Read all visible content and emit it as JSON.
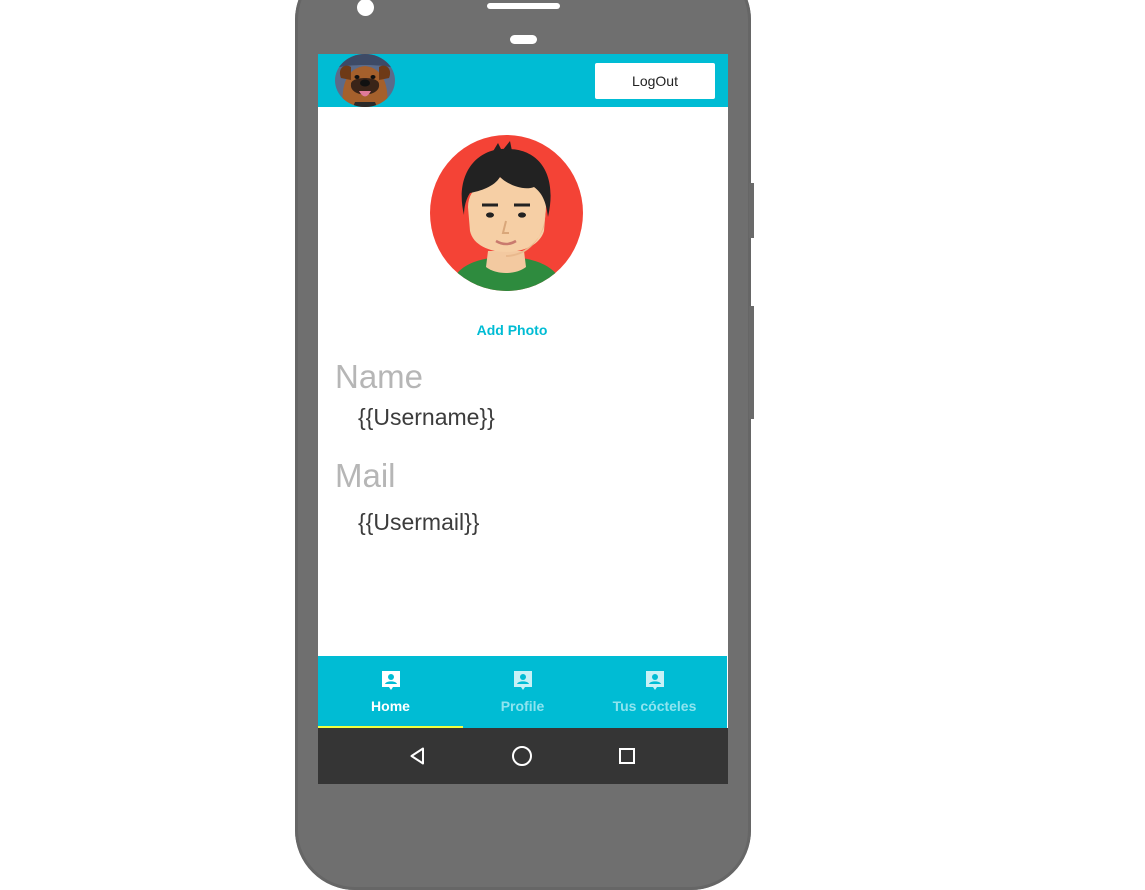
{
  "appbar": {
    "avatar_icon": "dog-avatar",
    "logout_label": "LogOut"
  },
  "profile": {
    "photo_icon": "user-avatar",
    "add_photo_label": "Add Photo",
    "name_label": "Name",
    "name_value": "{{Username}}",
    "mail_label": "Mail",
    "mail_value": "{{Usermail}}"
  },
  "tabs": [
    {
      "label": "Home",
      "icon": "account-box-icon",
      "active": true
    },
    {
      "label": "Profile",
      "icon": "account-box-icon",
      "active": false
    },
    {
      "label": "Tus cócteles",
      "icon": "account-box-icon",
      "active": false
    }
  ],
  "navbar": {
    "icons": [
      "back-triangle-icon",
      "home-circle-icon",
      "recents-square-icon"
    ]
  },
  "colors": {
    "primary": "#00bcd4",
    "indicator": "#eeff41",
    "avatar_bg": "#f44336",
    "nav_bg": "#353535"
  }
}
